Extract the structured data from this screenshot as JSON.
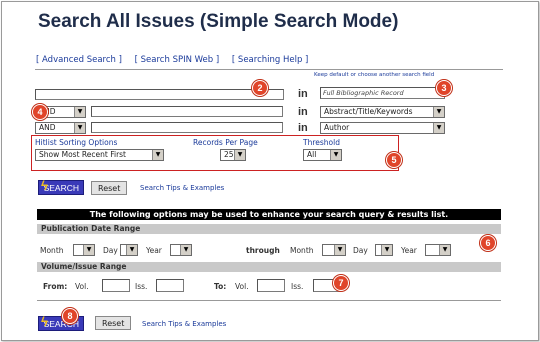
{
  "page": {
    "title": "Search All Issues (Simple Search Mode)"
  },
  "nav_links": [
    {
      "label": "[ Advanced Search ]"
    },
    {
      "label": "[ Search SPIN Web ]"
    },
    {
      "label": "[ Searching Help ]"
    }
  ],
  "field_hint": "Keep default or choose another search field",
  "rows": [
    {
      "operator": "",
      "value": "",
      "in_label": "in",
      "field": "Full Bibliographic Record"
    },
    {
      "operator": "AND",
      "value": "",
      "in_label": "in",
      "field": "Abstract/Title/Keywords"
    },
    {
      "operator": "AND",
      "value": "",
      "in_label": "in",
      "field": "Author"
    }
  ],
  "options": {
    "hitlist_label": "Hitlist Sorting Options",
    "hitlist_value": "Show Most Recent First",
    "records_label": "Records Per Page",
    "records_value": "25",
    "threshold_label": "Threshold",
    "threshold_value": "All"
  },
  "buttons": {
    "search": "SEARCH",
    "reset": "Reset",
    "tips": "Search Tips & Examples"
  },
  "enhance_bar": "The following options may be used to enhance your search query & results list.",
  "date_range": {
    "header": "Publication Date Range",
    "month": "Month",
    "day": "Day",
    "year": "Year",
    "through": "through"
  },
  "volume_range": {
    "header": "Volume/Issue Range",
    "from": "From:",
    "to": "To:",
    "vol": "Vol.",
    "iss": "Iss."
  },
  "callouts": [
    "2",
    "3",
    "4",
    "5",
    "6",
    "7",
    "8"
  ],
  "colors": {
    "title": "#1f2d4a",
    "link": "#1a3a9a",
    "callout": "#e0452a",
    "options_border": "#cc2222",
    "search_button": "#3a3ab8"
  }
}
